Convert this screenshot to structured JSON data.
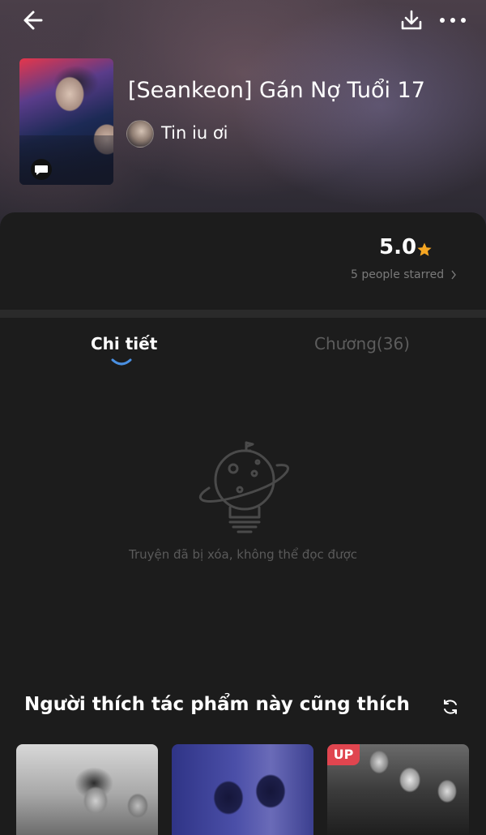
{
  "header": {
    "back_icon": "arrow-left-icon",
    "download_icon": "download-icon",
    "more_icon": "more-horizontal-icon"
  },
  "story": {
    "title": "[Seankeon] Gán Nợ Tuổi 17",
    "author": "Tin iu ơi",
    "cover_badge_icon": "chat-bubble-icon"
  },
  "rating": {
    "value": "5.0",
    "count_text": "5 people starred",
    "star_color": "#f5a623"
  },
  "tabs": [
    {
      "label": "Chi tiết",
      "active": true
    },
    {
      "label": "Chương(36)",
      "active": false
    }
  ],
  "tab_indicator_color": "#4a90e2",
  "empty_state": {
    "icon": "planet-lightbulb-icon",
    "message": "Truyện đã bị xóa, không thể đọc được"
  },
  "recommendations": {
    "title": "Người thích tác phẩm này cũng thích",
    "refresh_icon": "refresh-icon",
    "items": [
      {
        "badge": ""
      },
      {
        "badge": ""
      },
      {
        "badge": "UP"
      }
    ]
  }
}
